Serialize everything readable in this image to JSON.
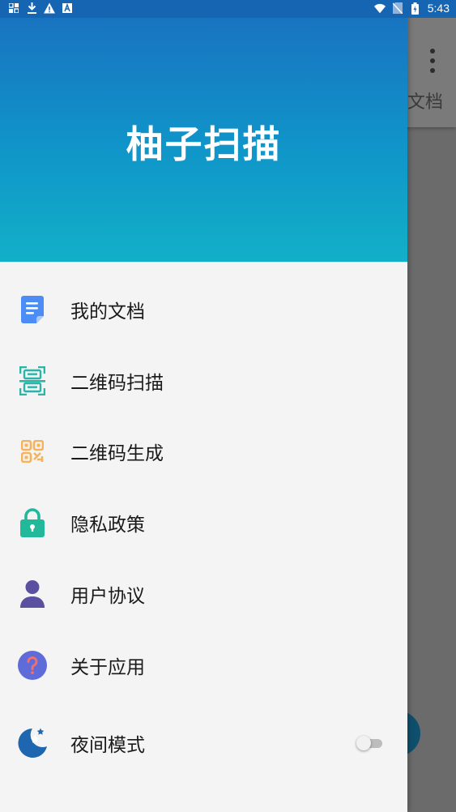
{
  "status_bar": {
    "time": "5:43",
    "icons_left": [
      "data-icon",
      "download-icon",
      "warning-icon",
      "a-icon"
    ],
    "icons_right": [
      "wifi-icon",
      "no-sim-icon",
      "battery-icon"
    ]
  },
  "background_app": {
    "tab_label": "文档",
    "overflow_menu": "more-vertical-icon"
  },
  "drawer": {
    "title": "柚子扫描",
    "header_gradient": [
      "#1a6fbf",
      "#12b0c8"
    ],
    "items": [
      {
        "label": "我的文档",
        "icon": "document-icon",
        "color": "#4b8df5"
      },
      {
        "label": "二维码扫描",
        "icon": "qr-scan-icon",
        "color": "#2bb5a8"
      },
      {
        "label": "二维码生成",
        "icon": "qr-generate-icon",
        "color": "#f5b35c"
      },
      {
        "label": "隐私政策",
        "icon": "lock-icon",
        "color": "#22b89a"
      },
      {
        "label": "用户协议",
        "icon": "user-icon",
        "color": "#5b4fa0"
      },
      {
        "label": "关于应用",
        "icon": "help-icon",
        "color": "#5e6bd8"
      },
      {
        "label": "夜间模式",
        "icon": "night-mode-icon",
        "color": "#1f66b0",
        "toggle": false
      }
    ]
  }
}
